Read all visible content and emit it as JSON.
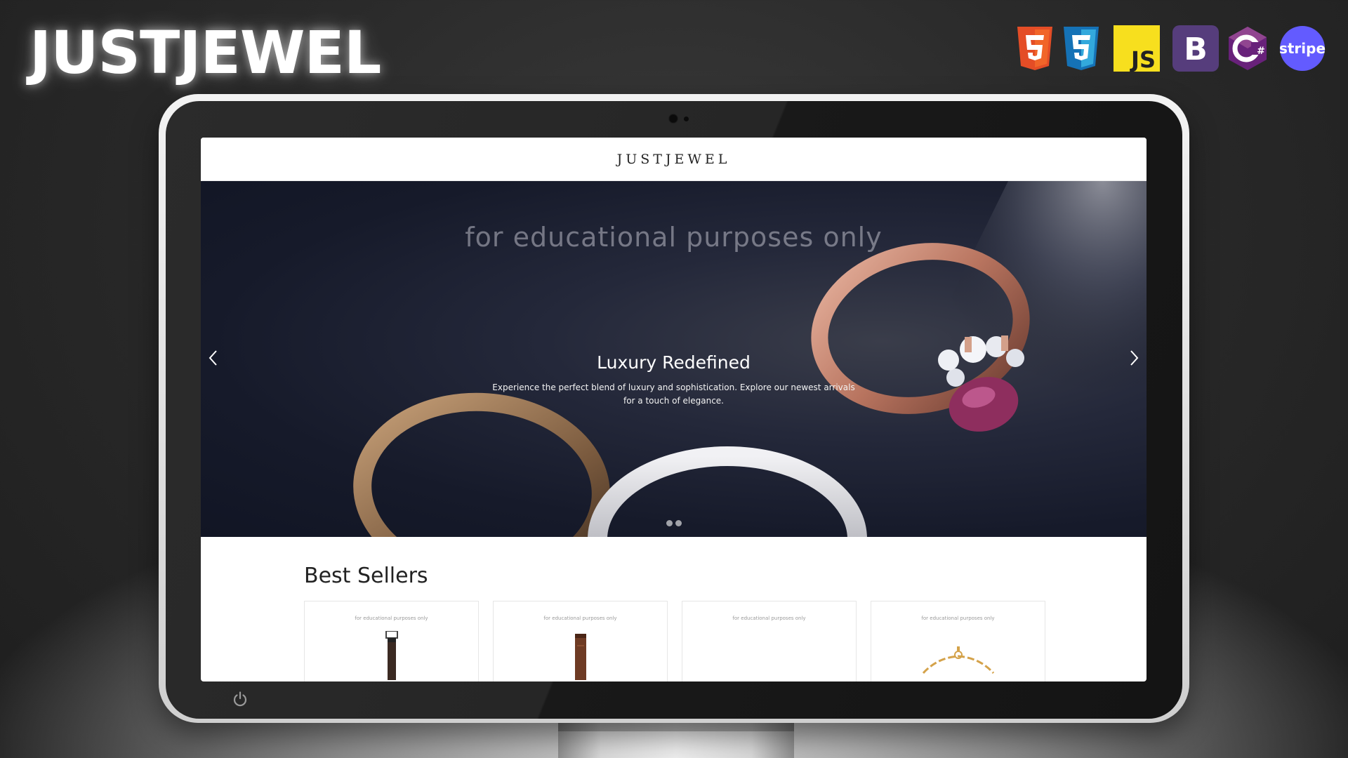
{
  "banner": {
    "title": "JUSTJEWEL",
    "tech_icons": [
      "html5-icon",
      "css3-icon",
      "javascript-icon",
      "bootstrap-icon",
      "csharp-icon",
      "stripe-icon"
    ],
    "tech_labels": {
      "js": "JS",
      "bootstrap": "B",
      "stripe": "stripe"
    }
  },
  "site": {
    "logo": "JUSTJEWEL",
    "hero": {
      "watermark": "for educational purposes only",
      "slide_title": "Luxury Redefined",
      "slide_text": "Experience the perfect blend of luxury and sophistication. Explore our newest arrivals for a touch of elegance.",
      "slide_count": 2,
      "active_slide": 1
    },
    "best_sellers": {
      "title": "Best Sellers",
      "products": [
        {
          "watermark": "for educational purposes only",
          "image": "watch-dark-strap"
        },
        {
          "watermark": "for educational purposes only",
          "image": "watch-brown-strap"
        },
        {
          "watermark": "for educational purposes only",
          "image": ""
        },
        {
          "watermark": "for educational purposes only",
          "image": "gold-chain-bracelet"
        }
      ]
    }
  },
  "colors": {
    "background": "#2a2a2a",
    "hero_bg": "#161a2a",
    "html5": "#e44d26",
    "css3": "#1572b6",
    "js": "#f7df1e",
    "bootstrap": "#563d7c",
    "csharp": "#68217a",
    "stripe": "#635bff"
  }
}
